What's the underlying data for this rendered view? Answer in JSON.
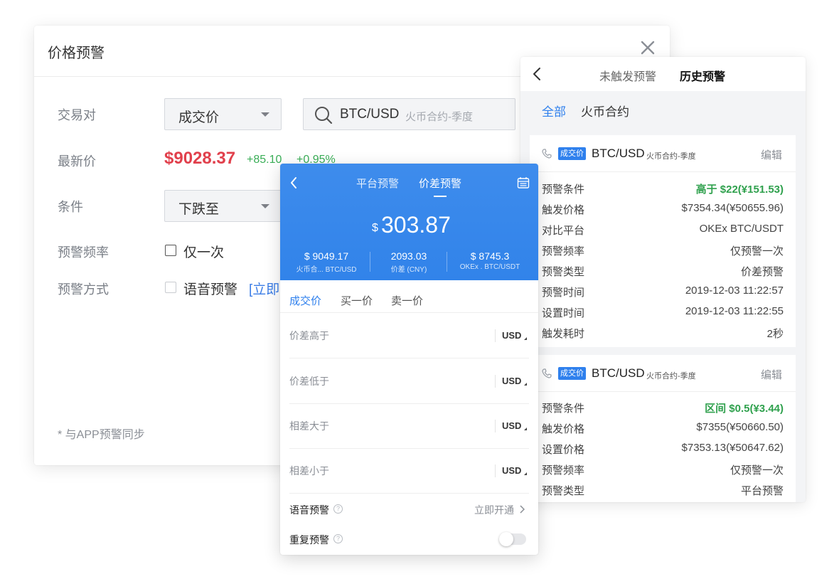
{
  "price_alert_dialog": {
    "title": "价格预警",
    "close_icon": "close-icon",
    "fields": {
      "pair_label": "交易对",
      "price_type_value": "成交价",
      "search_pair": "BTC/USD",
      "search_sub": "火币合约-季度",
      "latest_label": "最新价",
      "latest_price": "$9028.37",
      "change_abs": "+85.10",
      "change_pct": "+0.95%",
      "condition_label": "条件",
      "condition_value": "下跌至",
      "frequency_label": "预警频率",
      "frequency_option": "仅一次",
      "method_label": "预警方式",
      "method_option": "语音预警",
      "method_link": "[立即"
    },
    "footnote": "* 与APP预警同步"
  },
  "history_panel": {
    "tabs": [
      "未触发预警",
      "历史预警"
    ],
    "active_tab": "历史预警",
    "filters": [
      "全部",
      "火币合约"
    ],
    "active_filter": "全部",
    "cards": [
      {
        "badge": "成交价",
        "pair": "BTC/USD",
        "sub": "火币合约-季度",
        "edit": "编辑",
        "rows": [
          {
            "k": "预警条件",
            "v": "高于 $22(¥151.53)",
            "green": true
          },
          {
            "k": "触发价格",
            "v": "$7354.34(¥50655.96)"
          },
          {
            "k": "对比平台",
            "v": "OKEx BTC/USDT"
          },
          {
            "k": "预警频率",
            "v": "仅预警一次"
          },
          {
            "k": "预警类型",
            "v": "价差预警"
          },
          {
            "k": "预警时间",
            "v": "2019-12-03 11:22:57"
          },
          {
            "k": "设置时间",
            "v": "2019-12-03 11:22:55"
          },
          {
            "k": "触发耗时",
            "v": "2秒"
          }
        ]
      },
      {
        "badge": "成交价",
        "pair": "BTC/USD",
        "sub": "火币合约-季度",
        "edit": "编辑",
        "rows": [
          {
            "k": "预警条件",
            "v": "区间 $0.5(¥3.44)",
            "green": true
          },
          {
            "k": "触发价格",
            "v": "$7355(¥50660.50)"
          },
          {
            "k": "设置价格",
            "v": "$7353.13(¥50647.62)"
          },
          {
            "k": "预警频率",
            "v": "仅预警一次"
          },
          {
            "k": "预警类型",
            "v": "平台预警"
          }
        ]
      }
    ]
  },
  "spread_panel": {
    "tabs": [
      "平台预警",
      "价差预警"
    ],
    "active_tab": "价差预警",
    "currency_symbol": "$",
    "spread_value": "303.87",
    "columns": [
      {
        "value": "$ 9049.17",
        "label": "火币合... BTC/USD"
      },
      {
        "value": "2093.03",
        "label": "价差 (CNY)"
      },
      {
        "value": "$ 8745.3",
        "label": "OKEx . BTC/USDT"
      }
    ],
    "price_tabs": [
      "成交价",
      "买一价",
      "卖一价"
    ],
    "active_price_tab": "成交价",
    "rows": [
      {
        "label": "价差高于",
        "unit": "USD"
      },
      {
        "label": "价差低于",
        "unit": "USD"
      },
      {
        "label": "相差大于",
        "unit": "USD"
      },
      {
        "label": "相差小于",
        "unit": "USD"
      }
    ],
    "voice_alert": {
      "label": "语音预警",
      "help": "?",
      "link": "立即开通"
    },
    "repeat_alert": {
      "label": "重复预警",
      "help": "?",
      "enabled": false
    }
  }
}
